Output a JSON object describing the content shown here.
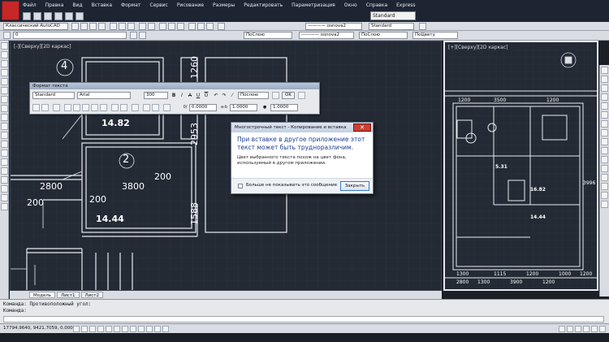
{
  "menu": [
    "Файл",
    "Правка",
    "Вид",
    "Вставка",
    "Формат",
    "Сервис",
    "Рисование",
    "Размеры",
    "Редактировать",
    "Параметризация",
    "Окно",
    "Справка",
    "Express"
  ],
  "toolbar": {
    "workspace": "Классический AutoCAD",
    "layer": "0",
    "linetype_by_layer": "ПоСлою",
    "lineweight_by_layer": "ПоСлою",
    "linetype_mid": "———— osnova2",
    "plotstyle": "ПоЦвету",
    "textstyle": "Standard",
    "dimstyle": "Standard"
  },
  "viewports": {
    "left_label": "[-][Сверху][2D каркас]",
    "right_label": "[+][Сверху][2D каркас]"
  },
  "drawing": {
    "left_texts": [
      "14.82",
      "14.44",
      "2800",
      "3800",
      "3800",
      "200",
      "200",
      "200",
      "1260",
      "2953",
      "1588",
      "2",
      "4"
    ],
    "right_texts": [
      "1200",
      "3500",
      "1200",
      "2800",
      "1300",
      "3900",
      "1200",
      "16.82",
      "14.44",
      "5.31",
      "3996",
      "1300",
      "1115",
      "1200",
      "1000",
      "1200"
    ]
  },
  "tabs": {
    "model": "Модель",
    "sheet1": "Лист1",
    "sheet2": "Лист2"
  },
  "command": {
    "line1": "Команда: Противоположный угол:",
    "line2": "Команда:"
  },
  "status": {
    "coords": "17794.9640, 9421.7059, 0.0000"
  },
  "text_format": {
    "title": "Формат текста",
    "style": "Standard",
    "font": "Arial",
    "height": "300",
    "color": "Послою",
    "ok": "OK",
    "oblique": "0.0000",
    "tracking": "1.0000",
    "width": "1.0000"
  },
  "dialog": {
    "title": "Многострочный текст - Копирование и вставка",
    "message": "При вставке в другое приложение этот текст может быть трудноразличим.",
    "details": "Цвет выбранного текста похож на цвет фона, используемый в другом приложении.",
    "checkbox_label": "Больше не показывать это сообщение",
    "close_button": "Закрыть"
  }
}
